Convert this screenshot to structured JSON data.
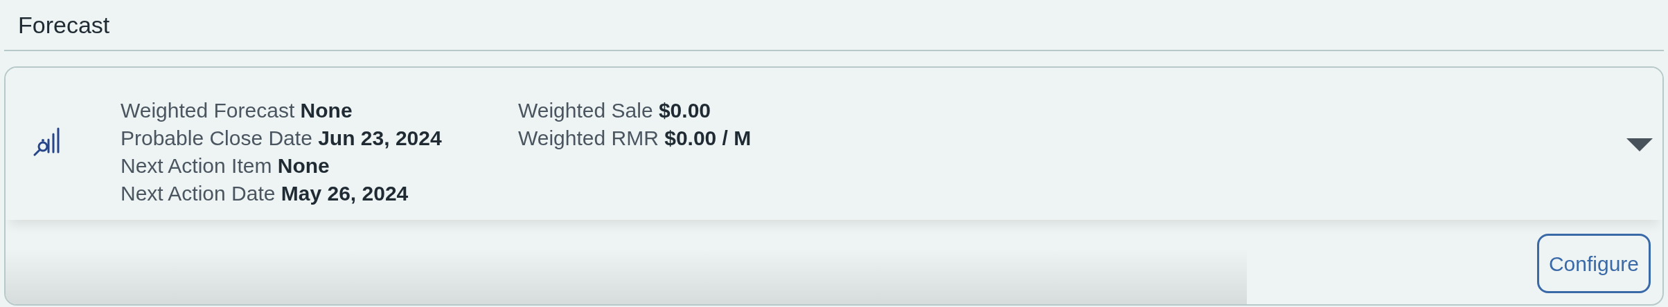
{
  "section_title": "Forecast",
  "card": {
    "fields_left": [
      {
        "label": "Weighted Forecast",
        "value": "None"
      },
      {
        "label": "Probable Close Date",
        "value": "Jun 23, 2024"
      },
      {
        "label": "Next Action Item",
        "value": "None"
      },
      {
        "label": "Next Action Date",
        "value": "May 26, 2024"
      }
    ],
    "fields_right": [
      {
        "label": "Weighted Sale",
        "value": "$0.00"
      },
      {
        "label": "Weighted RMR",
        "value": "$0.00 / M"
      }
    ],
    "configure_button": "Configure"
  }
}
